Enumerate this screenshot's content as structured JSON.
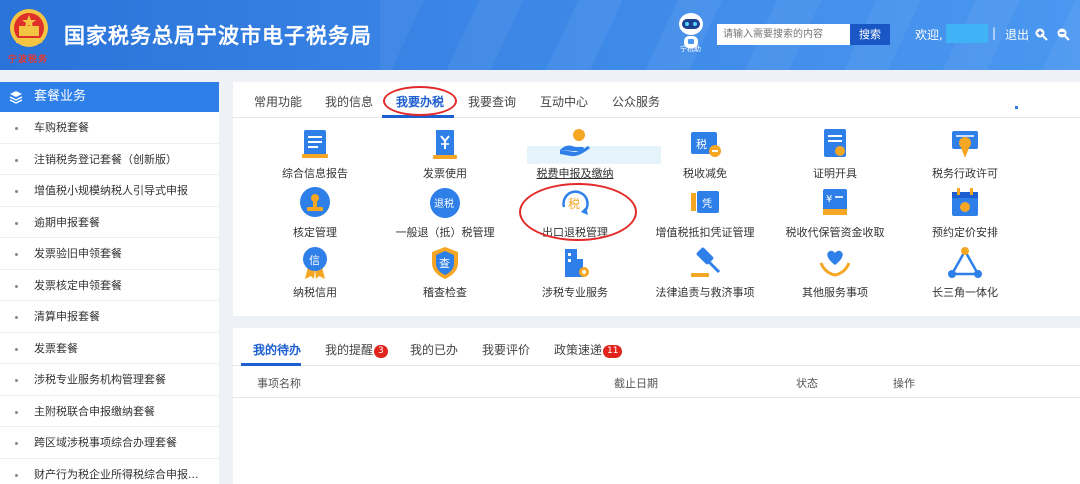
{
  "header": {
    "site_title": "国家税务总局宁波市电子税务局",
    "seal_text": "宁波税务",
    "robot_label": "宁税助",
    "search_placeholder": "请输入需要搜索的内容",
    "search_button": "搜索",
    "welcome": "欢迎,",
    "separator": "|",
    "logout": "退出"
  },
  "sidebar": {
    "title": "套餐业务",
    "items": [
      "车购税套餐",
      "注销税务登记套餐（创新版）",
      "增值税小规模纳税人引导式申报",
      "逾期申报套餐",
      "发票验旧申领套餐",
      "发票核定申领套餐",
      "清算申报套餐",
      "发票套餐",
      "涉税专业服务机构管理套餐",
      "主附税联合申报缴纳套餐",
      "跨区域涉税事项综合办理套餐",
      "财产行为税企业所得税综合申报..."
    ]
  },
  "main_tabs": [
    "常用功能",
    "我的信息",
    "我要办税",
    "我要查询",
    "互动中心",
    "公众服务"
  ],
  "functions": [
    {
      "label": "综合信息报告",
      "icon": "report-icon"
    },
    {
      "label": "发票使用",
      "icon": "invoice-icon"
    },
    {
      "label": "税费申报及缴纳",
      "icon": "declare-pay-icon"
    },
    {
      "label": "税收减免",
      "icon": "tax-relief-icon"
    },
    {
      "label": "证明开具",
      "icon": "certificate-icon"
    },
    {
      "label": "税务行政许可",
      "icon": "license-icon"
    },
    {
      "label": "核定管理",
      "icon": "stamp-icon"
    },
    {
      "label": "一般退（抵）税管理",
      "icon": "refund-icon"
    },
    {
      "label": "出口退税管理",
      "icon": "export-refund-icon"
    },
    {
      "label": "增值税抵扣凭证管理",
      "icon": "voucher-icon"
    },
    {
      "label": "税收代保管资金收取",
      "icon": "custody-fund-icon"
    },
    {
      "label": "预约定价安排",
      "icon": "calendar-icon"
    },
    {
      "label": "纳税信用",
      "icon": "credit-medal-icon"
    },
    {
      "label": "稽查检查",
      "icon": "inspection-shield-icon"
    },
    {
      "label": "涉税专业服务",
      "icon": "building-gear-icon"
    },
    {
      "label": "法律追责与救济事项",
      "icon": "gavel-icon"
    },
    {
      "label": "其他服务事项",
      "icon": "heart-hand-icon"
    },
    {
      "label": "长三角一体化",
      "icon": "triangle-network-icon"
    }
  ],
  "icon_tiles": {
    "refund": "退税",
    "export": "税",
    "credit": "信",
    "inspect": "查",
    "relief": "税",
    "voucher": "凭",
    "custody": "¥"
  },
  "bottom_tabs": [
    {
      "label": "我的待办",
      "badge": ""
    },
    {
      "label": "我的提醒",
      "badge": "3"
    },
    {
      "label": "我的已办",
      "badge": ""
    },
    {
      "label": "我要评价",
      "badge": ""
    },
    {
      "label": "政策速递",
      "badge": "11"
    }
  ],
  "table_headers": [
    "事项名称",
    "截止日期",
    "状态",
    "操作"
  ],
  "colors": {
    "primary": "#2e7fe8",
    "active_text": "#1d5fd1",
    "annotation_red": "#e32a2a",
    "badge_red": "#e0241b",
    "icon_orange": "#f5a623"
  }
}
